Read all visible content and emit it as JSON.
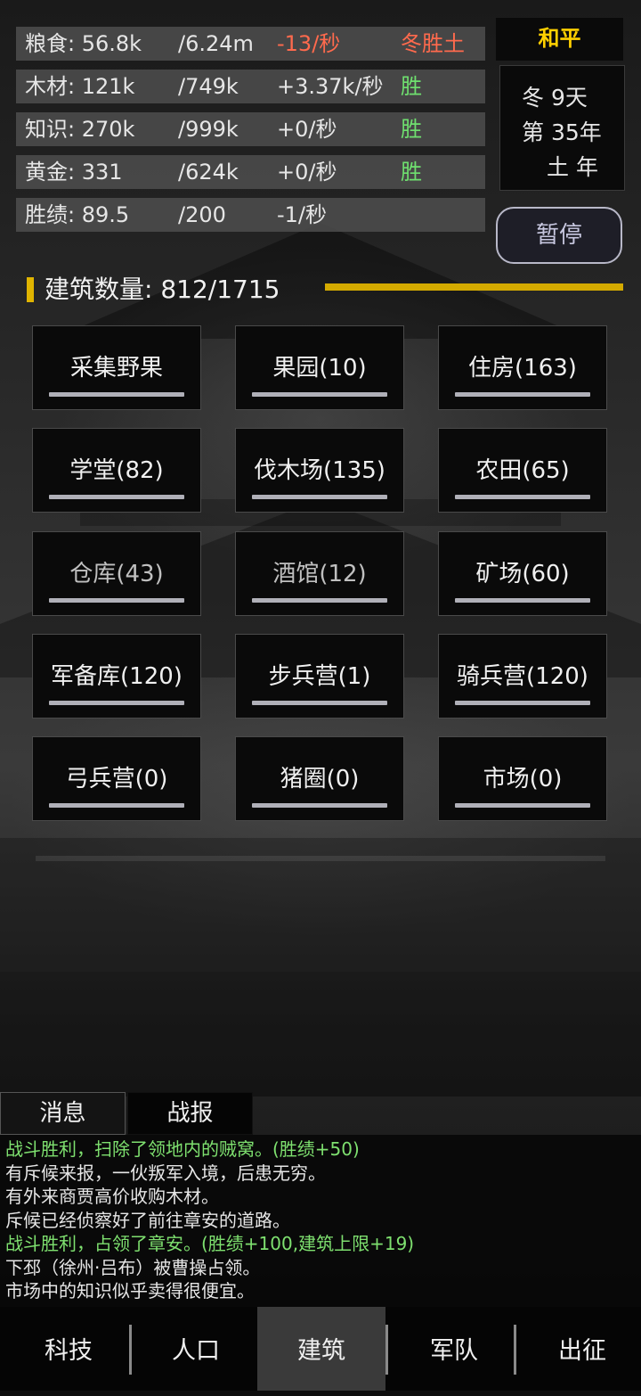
{
  "resources": [
    {
      "name": "粮食: 56.8k",
      "max": "/6.24m",
      "rate": "-13/秒",
      "flag": "冬胜土"
    },
    {
      "name": "木材: 121k",
      "max": "/749k",
      "rate": "+3.37k/秒",
      "flag": "胜"
    },
    {
      "name": "知识: 270k",
      "max": "/999k",
      "rate": "+0/秒",
      "flag": "胜"
    },
    {
      "name": "黄金: 331",
      "max": "/624k",
      "rate": "+0/秒",
      "flag": "胜"
    },
    {
      "name": "胜绩: 89.5",
      "max": "/200",
      "rate": "-1/秒",
      "flag": ""
    }
  ],
  "status": {
    "peace": "和平",
    "season_day": "冬 9天",
    "year": "第 35年",
    "element_year": "土 年"
  },
  "pause_label": "暂停",
  "building_count": "建筑数量: 812/1715",
  "buildings": [
    "采集野果",
    "果园(10)",
    "住房(163)",
    "学堂(82)",
    "伐木场(135)",
    "农田(65)",
    "仓库(43)",
    "酒馆(12)",
    "矿场(60)",
    "军备库(120)",
    "步兵营(1)",
    "骑兵营(120)",
    "弓兵营(0)",
    "猪圈(0)",
    "市场(0)"
  ],
  "log_tabs": {
    "messages": "消息",
    "battle": "战报"
  },
  "log": [
    "战斗胜利，扫除了领地内的贼窝。(胜绩+50)",
    "有斥候来报，一伙叛军入境，后患无穷。",
    "有外来商贾高价收购木材。",
    "斥候已经侦察好了前往章安的道路。",
    "战斗胜利，占领了章安。(胜绩+100,建筑上限+19)",
    "下邳（徐州·吕布）被曹操占领。",
    "市场中的知识似乎卖得很便宜。"
  ],
  "nav": [
    "科技",
    "人口",
    "建筑",
    "军队",
    "出征"
  ],
  "colors": {
    "gold": "#d4aa00",
    "positive": "#6fe06f",
    "negative": "#ff6a4d"
  }
}
